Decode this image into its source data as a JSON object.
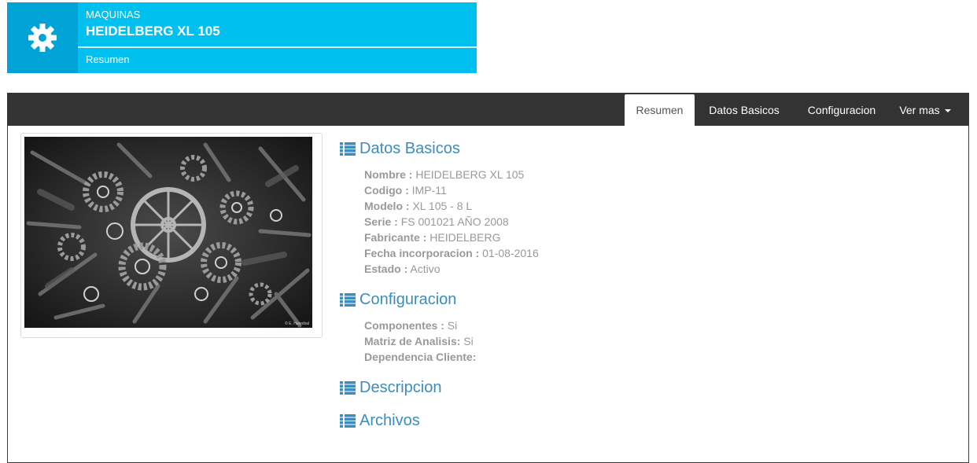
{
  "header": {
    "category": "MAQUINAS",
    "title": "HEIDELBERG XL 105",
    "subtitle": "Resumen",
    "icon": "gear-icon",
    "colors": {
      "icon_bg": "#00a3d6",
      "body_bg": "#00c0ef"
    }
  },
  "tabs": [
    {
      "label": "Resumen",
      "active": true
    },
    {
      "label": "Datos Basicos",
      "active": false
    },
    {
      "label": "Configuracion",
      "active": false
    },
    {
      "label": "Ver mas",
      "active": false
    }
  ],
  "image": {
    "caption": "© E. Hannibal"
  },
  "datos_basicos": {
    "title": "Datos Basicos",
    "fields": [
      {
        "label": "Nombre :",
        "value": "HEIDELBERG XL 105"
      },
      {
        "label": "Codigo :",
        "value": "IMP-11"
      },
      {
        "label": "Modelo :",
        "value": "XL 105 - 8 L"
      },
      {
        "label": "Serie :",
        "value": "FS 001021 AÑO 2008"
      },
      {
        "label": "Fabricante :",
        "value": "HEIDELBERG"
      },
      {
        "label": "Fecha incorporacion :",
        "value": "01-08-2016"
      },
      {
        "label": "Estado :",
        "value": "Activo"
      }
    ]
  },
  "configuracion": {
    "title": "Configuracion",
    "fields": [
      {
        "label": "Componentes :",
        "value": "Si"
      },
      {
        "label": "Matriz de Analisis:",
        "value": "Si"
      },
      {
        "label": "Dependencia Cliente:",
        "value": ""
      }
    ]
  },
  "descripcion": {
    "title": "Descripcion"
  },
  "archivos": {
    "title": "Archivos"
  }
}
